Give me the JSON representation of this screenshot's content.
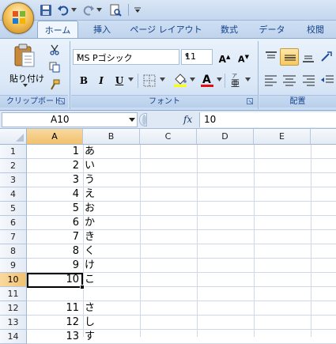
{
  "ribbon_tabs": [
    "ホーム",
    "挿入",
    "ページ レイアウト",
    "数式",
    "データ",
    "校閲"
  ],
  "clipboard": {
    "paste_label": "貼り付け",
    "group_label": "クリップボード"
  },
  "font": {
    "name": "MS Pゴシック",
    "size": "11",
    "group_label": "フォント",
    "bold": "B",
    "italic": "I",
    "underline": "U"
  },
  "alignment": {
    "group_label": "配置"
  },
  "formula_bar": {
    "name_box": "A10",
    "fx_label": "fx",
    "value": "10"
  },
  "columns": [
    "A",
    "B",
    "C",
    "D",
    "E"
  ],
  "rows": [
    {
      "num": "1",
      "a": "1",
      "b": "あ"
    },
    {
      "num": "2",
      "a": "2",
      "b": "い"
    },
    {
      "num": "3",
      "a": "3",
      "b": "う"
    },
    {
      "num": "4",
      "a": "4",
      "b": "え"
    },
    {
      "num": "5",
      "a": "5",
      "b": "お"
    },
    {
      "num": "6",
      "a": "6",
      "b": "か"
    },
    {
      "num": "7",
      "a": "7",
      "b": "き"
    },
    {
      "num": "8",
      "a": "8",
      "b": "く"
    },
    {
      "num": "9",
      "a": "9",
      "b": "け"
    },
    {
      "num": "10",
      "a": "10",
      "b": "こ"
    },
    {
      "num": "11",
      "a": "",
      "b": ""
    },
    {
      "num": "12",
      "a": "11",
      "b": "さ"
    },
    {
      "num": "13",
      "a": "12",
      "b": "し"
    },
    {
      "num": "14",
      "a": "13",
      "b": "す"
    }
  ],
  "selected": {
    "column": "A",
    "row": "10"
  },
  "colors": {
    "accent": "#15428b",
    "selection": "#f1c16e",
    "font_color_bar": "#e01010",
    "fill_color_bar": "#ffff00"
  }
}
